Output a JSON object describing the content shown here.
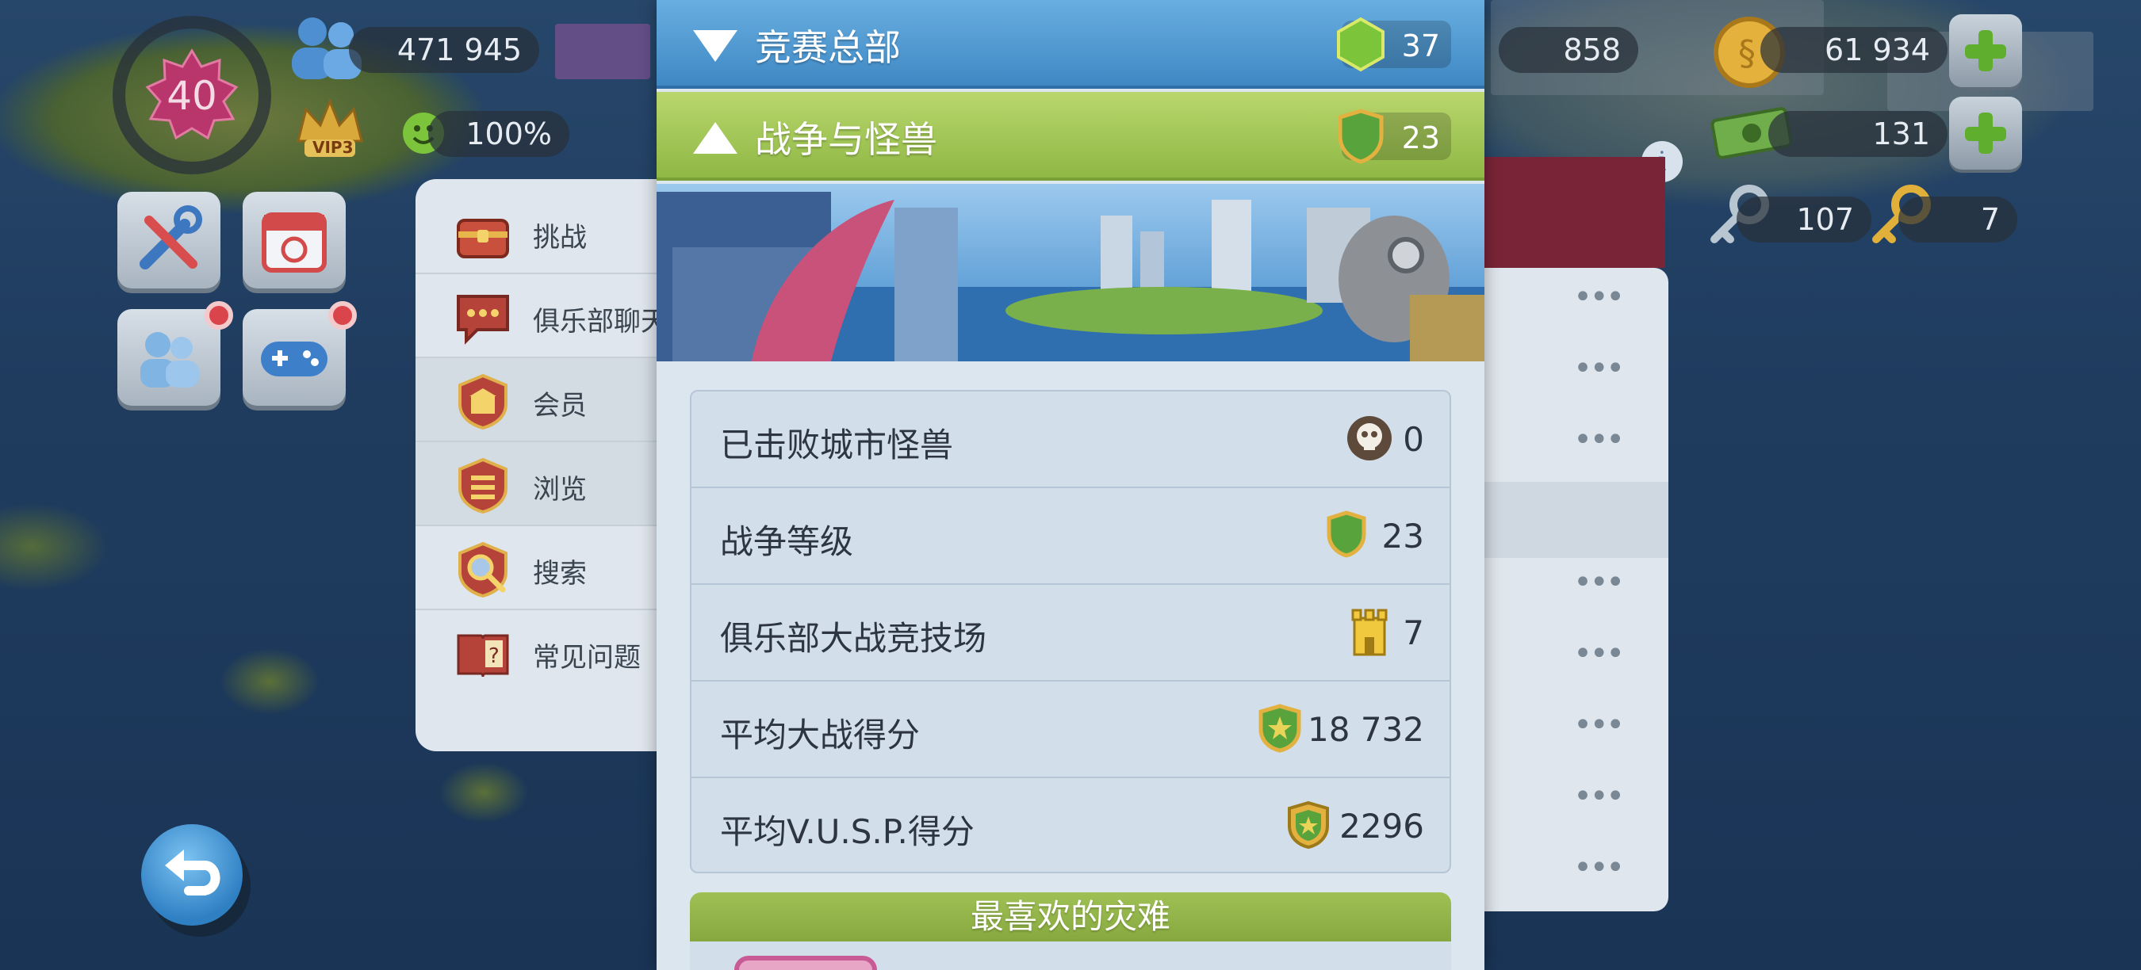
{
  "hud": {
    "level": "40",
    "population": "471 945",
    "happiness": "100%",
    "vip_label": "VIP3",
    "currency_858": "858",
    "simoleons": "61 934",
    "cash": "131",
    "keys_silver": "107",
    "keys_gold": "7"
  },
  "side_menu": {
    "items": [
      {
        "label": "挑战",
        "icon": "chest-icon"
      },
      {
        "label": "俱乐部聊天",
        "icon": "chat-icon"
      },
      {
        "label": "会员",
        "icon": "members-icon"
      },
      {
        "label": "浏览",
        "icon": "browse-icon"
      },
      {
        "label": "搜索",
        "icon": "search-icon"
      },
      {
        "label": "常见问题",
        "icon": "faq-book-icon"
      }
    ]
  },
  "panel": {
    "header_contest": {
      "title": "竞赛总部",
      "value": "37"
    },
    "header_war": {
      "title": "战争与怪兽",
      "value": "23"
    },
    "stats": [
      {
        "label": "已击败城市怪兽",
        "value": "0",
        "icon": "skull-icon"
      },
      {
        "label": "战争等级",
        "value": "23",
        "icon": "war-shield-icon"
      },
      {
        "label": "俱乐部大战竞技场",
        "value": "7",
        "icon": "tower-icon"
      },
      {
        "label": "平均大战得分",
        "value": "18 732",
        "icon": "star-shield-icon"
      },
      {
        "label": "平均V.U.S.P.得分",
        "value": "2296",
        "icon": "vu-shield-icon"
      }
    ],
    "favorite_disaster_title": "最喜欢的灾难"
  },
  "colors": {
    "contest_blue": "#4f9bd3",
    "war_green": "#a3c75a",
    "panel_bg": "#dce6ef"
  }
}
